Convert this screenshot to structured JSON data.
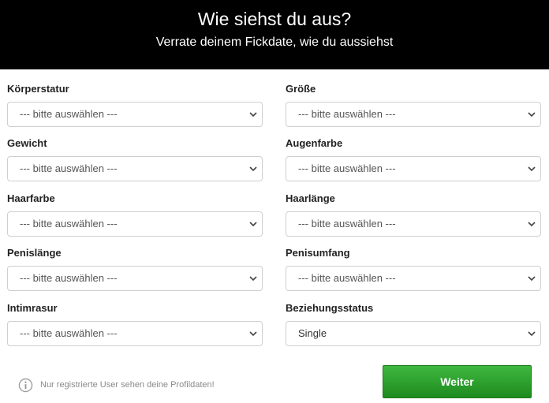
{
  "header": {
    "title": "Wie siehst du aus?",
    "subtitle": "Verrate deinem Fickdate, wie du aussiehst"
  },
  "fields": [
    {
      "label": "Körperstatur",
      "value": "--- bitte auswählen ---"
    },
    {
      "label": "Größe",
      "value": "--- bitte auswählen ---"
    },
    {
      "label": "Gewicht",
      "value": "--- bitte auswählen ---"
    },
    {
      "label": "Augenfarbe",
      "value": "--- bitte auswählen ---"
    },
    {
      "label": "Haarfarbe",
      "value": "--- bitte auswählen ---"
    },
    {
      "label": "Haarlänge",
      "value": "--- bitte auswählen ---"
    },
    {
      "label": "Penislänge",
      "value": "--- bitte auswählen ---"
    },
    {
      "label": "Penisumfang",
      "value": "--- bitte auswählen ---"
    },
    {
      "label": "Intimrasur",
      "value": "--- bitte auswählen ---"
    },
    {
      "label": "Beziehungsstatus",
      "value": "Single"
    }
  ],
  "footer": {
    "info_text": "Nur registrierte User sehen deine Profildaten!",
    "submit_label": "Weiter"
  },
  "colors": {
    "header_bg": "#000000",
    "submit_green": "#2ea32e"
  }
}
